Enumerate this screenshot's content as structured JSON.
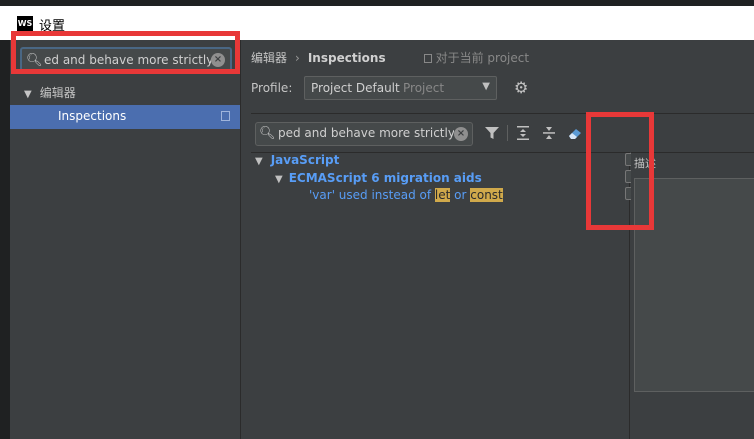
{
  "window": {
    "title": "设置",
    "app_icon_text": "WS"
  },
  "sidebar": {
    "search": {
      "value": "ed and behave more strictly"
    },
    "tree": [
      {
        "label": "编辑器",
        "expanded": true
      },
      {
        "label": "Inspections",
        "selected": true
      }
    ]
  },
  "breadcrumb": {
    "parent": "编辑器",
    "separator": "›",
    "current": "Inspections",
    "scope": "对于当前 project"
  },
  "profile": {
    "label": "Profile:",
    "name": "Project Default",
    "scope": "Project"
  },
  "inspections": {
    "search": {
      "value": "ped and behave more strictly"
    },
    "tree": {
      "group": "JavaScript",
      "subgroup": "ECMAScript 6 migration aids",
      "item": {
        "prefix": "'var' used instead of ",
        "kw1": "let",
        "mid": " or ",
        "kw2": "const"
      }
    },
    "checkboxes": [
      false,
      false,
      false
    ]
  },
  "description": {
    "label": "描述"
  },
  "annotation_color": "#e83838",
  "highlight_color": "#d0a94b",
  "link_color": "#589df6"
}
